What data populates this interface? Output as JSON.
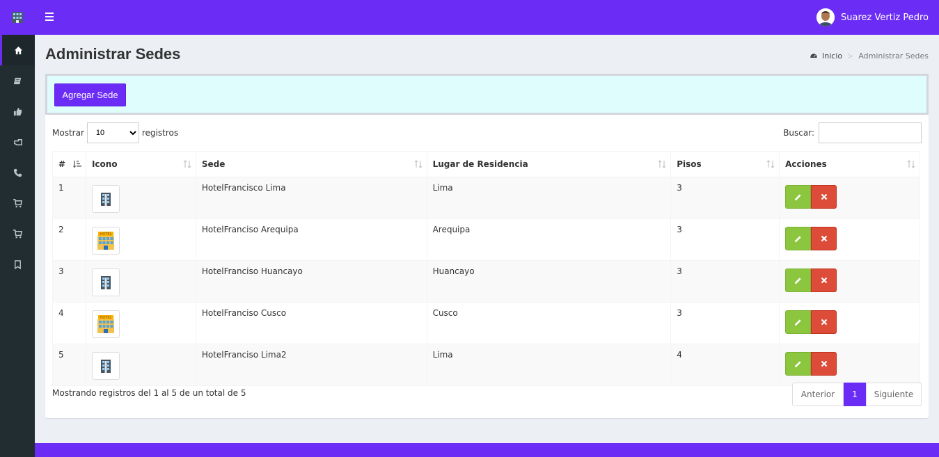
{
  "header": {
    "user_name": "Suarez Vertiz Pedro"
  },
  "page": {
    "title": "Administrar Sedes"
  },
  "breadcrumb": {
    "home": "Inicio",
    "current": "Administrar Sedes"
  },
  "toolbar": {
    "add_label": "Agregar Sede"
  },
  "table_controls": {
    "show_label": "Mostrar",
    "show_value": "10",
    "records_label": "registros",
    "search_label": "Buscar:",
    "search_value": ""
  },
  "columns": [
    "#",
    "Icono",
    "Sede",
    "Lugar de Residencia",
    "Pisos",
    "Acciones"
  ],
  "rows": [
    {
      "num": "1",
      "icon": "building-dark",
      "sede": "HotelFrancisco Lima",
      "lugar": "Lima",
      "pisos": "3"
    },
    {
      "num": "2",
      "icon": "hotel-colored",
      "sede": "HotelFranciso Arequipa",
      "lugar": "Arequipa",
      "pisos": "3"
    },
    {
      "num": "3",
      "icon": "building-dark",
      "sede": "HotelFranciso Huancayo",
      "lugar": "Huancayo",
      "pisos": "3"
    },
    {
      "num": "4",
      "icon": "hotel-colored",
      "sede": "HotelFranciso Cusco",
      "lugar": "Cusco",
      "pisos": "3"
    },
    {
      "num": "5",
      "icon": "building-dark",
      "sede": "HotelFranciso Lima2",
      "lugar": "Lima",
      "pisos": "4"
    }
  ],
  "footer_info": "Mostrando registros del 1 al 5 de un total de 5",
  "pagination": {
    "prev": "Anterior",
    "current": "1",
    "next": "Siguiente"
  },
  "colors": {
    "primary": "#6b2cf5",
    "sidebar": "#222d32",
    "edit": "#8cc63f",
    "delete": "#dd4b39",
    "panel_bg": "#dffdfd"
  }
}
